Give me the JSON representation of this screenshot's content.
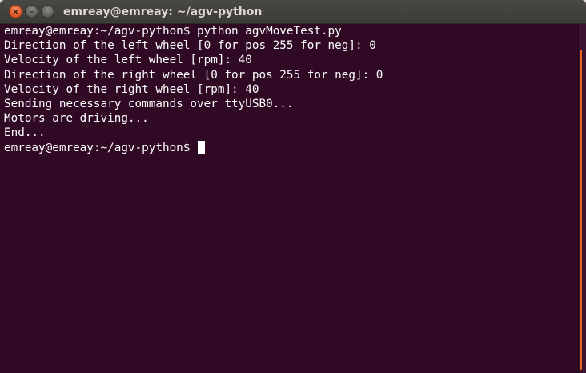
{
  "window": {
    "title": "emreay@emreay: ~/agv-python",
    "close_glyph": "×",
    "minimize_glyph": "–"
  },
  "terminal": {
    "lines": [
      "emreay@emreay:~/agv-python$ python agvMoveTest.py",
      "Direction of the left wheel [0 for pos 255 for neg]: 0",
      "Velocity of the left wheel [rpm]: 40",
      "Direction of the right wheel [0 for pos 255 for neg]: 0",
      "Velocity of the right wheel [rpm]: 40",
      "Sending necessary commands over ttyUSB0...",
      "Motors are driving...",
      "End..."
    ],
    "prompt": "emreay@emreay:~/agv-python$ "
  },
  "colors": {
    "terminal_background": "#300a24",
    "terminal_text": "#ffffff",
    "titlebar": "#3d3b37",
    "close_button": "#e25a2a",
    "scroll_thumb": "#e2641e"
  }
}
